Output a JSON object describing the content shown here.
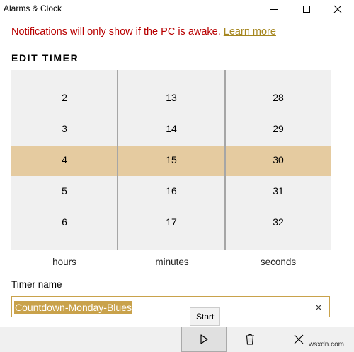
{
  "window": {
    "title": "Alarms & Clock"
  },
  "notice": {
    "text": "Notifications will only show if the PC is awake.",
    "link": "Learn more"
  },
  "edit_timer": {
    "heading": "EDIT TIMER"
  },
  "picker": {
    "hours": {
      "values": [
        "2",
        "3",
        "4",
        "5",
        "6"
      ],
      "selected": "4",
      "label": "hours"
    },
    "minutes": {
      "values": [
        "13",
        "14",
        "15",
        "16",
        "17"
      ],
      "selected": "15",
      "label": "minutes"
    },
    "seconds": {
      "values": [
        "28",
        "29",
        "30",
        "31",
        "32"
      ],
      "selected": "30",
      "label": "seconds"
    }
  },
  "timer_name": {
    "label": "Timer name",
    "value": "Countdown-Monday-Blues"
  },
  "toolbar": {
    "start_tooltip": "Start"
  },
  "watermark": "wsxdn.com",
  "colors": {
    "accent": "#c9a24b",
    "selection_band": "#e5cba0",
    "notice_red": "#b80000",
    "link": "#a5861f"
  }
}
